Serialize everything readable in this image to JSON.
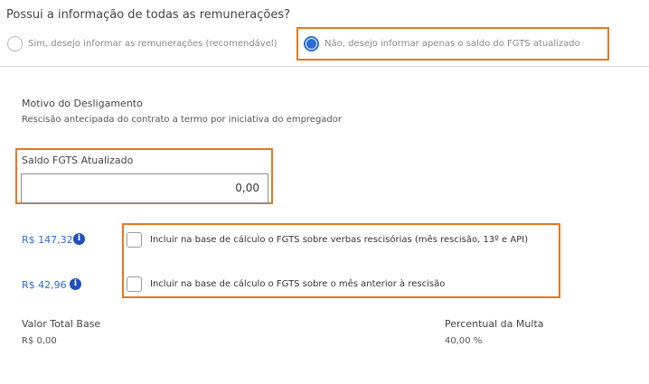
{
  "question": "Possui a informação de todas as remunerações?",
  "radio_options": {
    "yes_label": "Sim, desejo informar as remunerações (recomendável)",
    "no_label": "Não, desejo informar apenas o saldo do FGTS atualizado",
    "selected": "no"
  },
  "dismissal": {
    "label": "Motivo do Desligamento",
    "value": "Rescisão antecipada do contrato a termo por iniciativa do empregador"
  },
  "fgts_balance": {
    "label": "Saldo FGTS Atualizado",
    "value": "0,00"
  },
  "checks": [
    {
      "amount": "R$ 147,32",
      "label": "Incluir na base de cálculo o FGTS sobre verbas rescisórias (mês rescisão, 13º e API)",
      "checked": false
    },
    {
      "amount": "R$ 42,96",
      "label": "Incluir na base de cálculo o FGTS sobre o mês anterior à rescisão",
      "checked": false
    }
  ],
  "info_icon": "i",
  "summary": {
    "total_label": "Valor Total Base",
    "total_value": "R$ 0,00",
    "fine_label": "Percentual da Multa",
    "fine_value": "40,00 %"
  },
  "colors": {
    "accent": "#2b6cd6",
    "highlight": "#e8771d"
  }
}
